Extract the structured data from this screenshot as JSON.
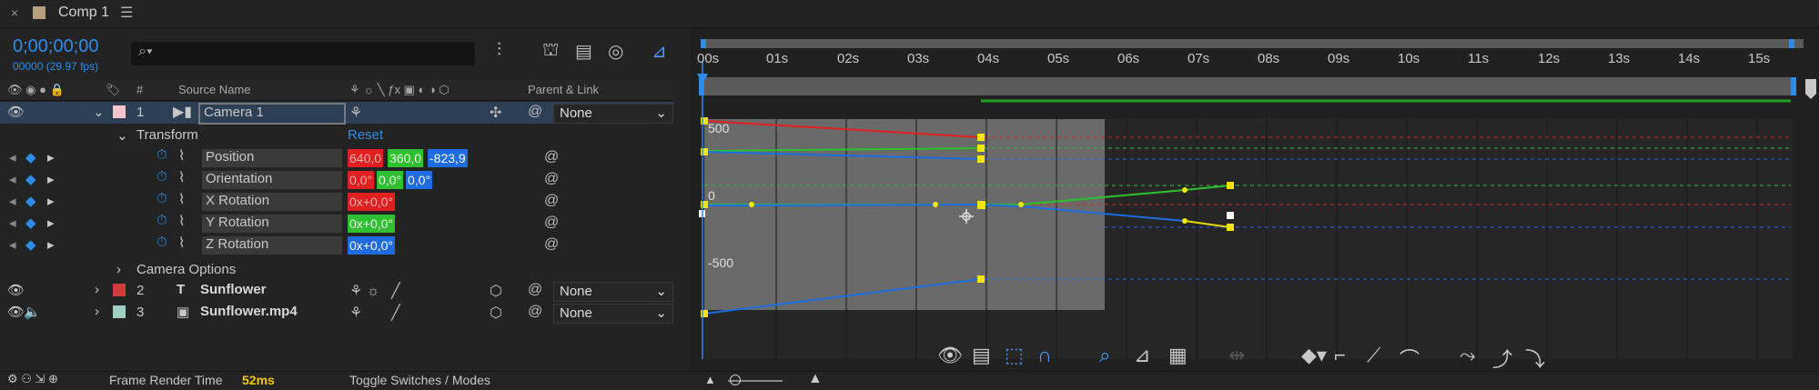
{
  "tab": {
    "title": "Comp 1",
    "close": "×",
    "menu": "☰"
  },
  "comp": {
    "timecode": "0;00;00;00",
    "frames": "00000 (29.97 fps)"
  },
  "search": {
    "icon": "search-icon",
    "placeholder": ""
  },
  "columns": {
    "source_name": "Source Name",
    "parent_link": "Parent & Link",
    "num": "#"
  },
  "layers": [
    {
      "num": "1",
      "name": "Camera 1",
      "parent": "None",
      "color": "#f2c5d0"
    },
    {
      "num": "2",
      "name": "Sunflower",
      "parent": "None",
      "color": "#d23b3b"
    },
    {
      "num": "3",
      "name": "Sunflower.mp4",
      "parent": "None",
      "color": "#9fcfc3"
    }
  ],
  "transform": {
    "label": "Transform",
    "reset": "Reset"
  },
  "properties": [
    {
      "name": "Position",
      "values": [
        "640,0",
        "360,0",
        "-823,9"
      ]
    },
    {
      "name": "Orientation",
      "values": [
        "0,0°",
        "0,0°",
        "0,0°"
      ]
    },
    {
      "name": "X Rotation",
      "values": [
        "0x+0,0°"
      ]
    },
    {
      "name": "Y Rotation",
      "values": [
        "0x+0,0°"
      ]
    },
    {
      "name": "Z Rotation",
      "values": [
        "0x+0,0°"
      ]
    }
  ],
  "camera_options": "Camera Options",
  "ruler": [
    "00s",
    "01s",
    "02s",
    "03s",
    "04s",
    "05s",
    "06s",
    "07s",
    "08s",
    "09s",
    "10s",
    "11s",
    "12s",
    "13s",
    "14s",
    "15s"
  ],
  "graph_labels": {
    "top": "500",
    "mid": "0",
    "bottom": "-500"
  },
  "status": {
    "frame_render_label": "Frame Render Time",
    "frame_render_value": "52ms",
    "toggle": "Toggle Switches / Modes"
  },
  "colors": {
    "accent": "#2d8ceb",
    "red": "#e02020",
    "green": "#2fc02f",
    "blue": "#1d6ce0",
    "keyframe": "#f2e600"
  }
}
